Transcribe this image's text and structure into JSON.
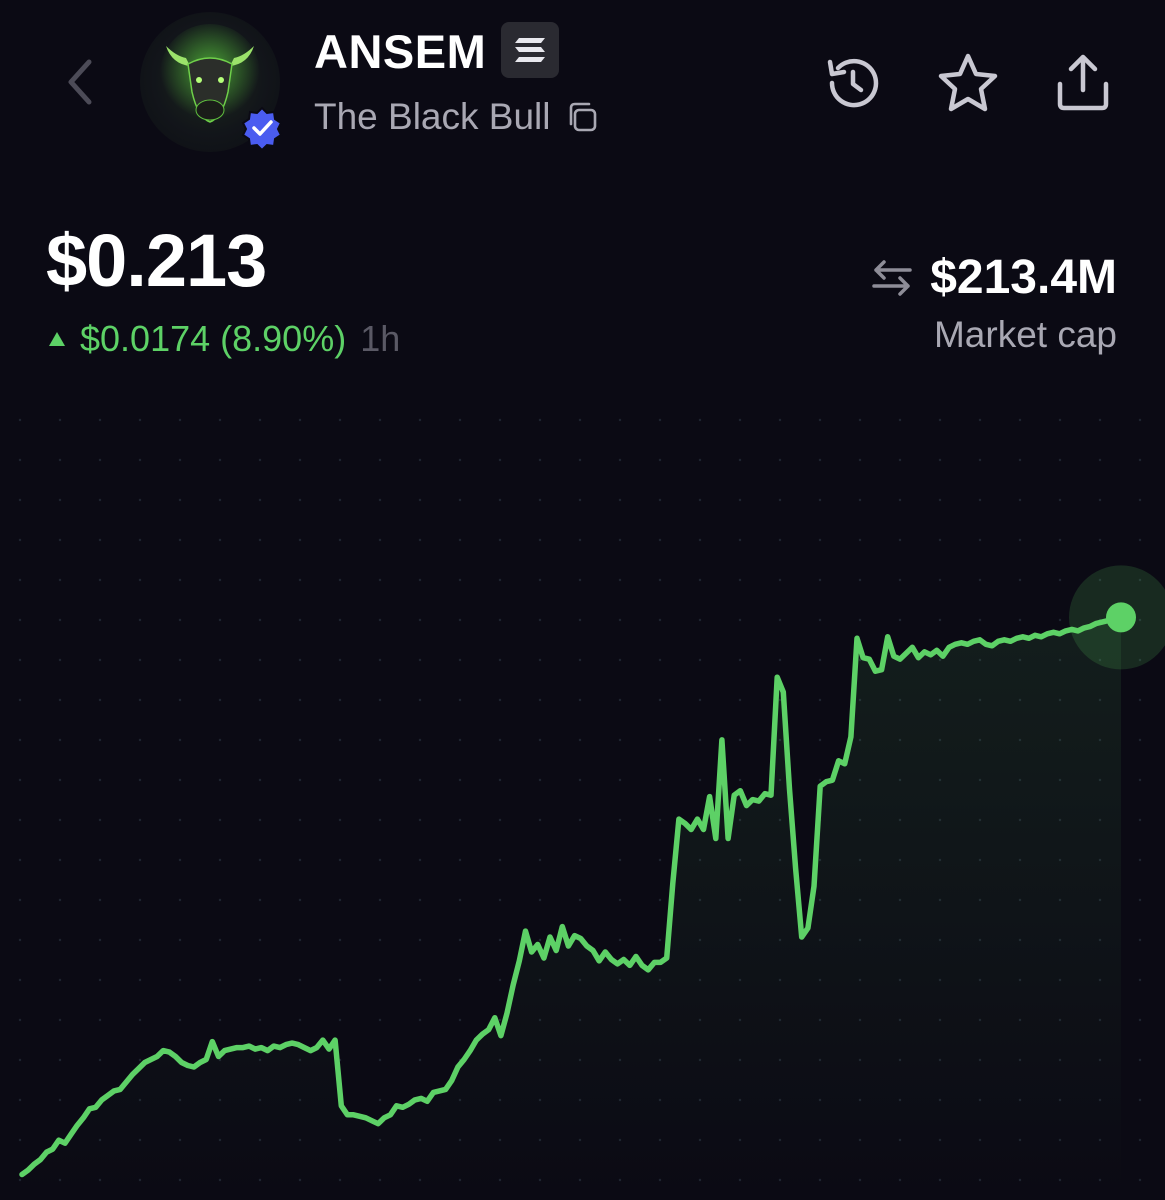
{
  "header": {
    "token_name": "ANSEM",
    "token_subtitle": "The Black Bull",
    "avatar_icon": "bull-icon",
    "verified_icon": "verified-badge-icon",
    "chain_icon": "solana-icon"
  },
  "toolbar": {
    "back_icon": "chevron-left-icon",
    "history_icon": "history-icon",
    "favorite_icon": "star-icon",
    "share_icon": "share-icon"
  },
  "price": {
    "current": "$0.213",
    "change": "$0.0174 (8.90%)",
    "period": "1h",
    "direction": "up"
  },
  "market_cap": {
    "value": "$213.4M",
    "label": "Market cap",
    "swap_icon": "swap-arrows-icon"
  },
  "colors": {
    "background": "#0b0a14",
    "line": "#5dd166",
    "muted_text": "#a9a8b3",
    "verified": "#4a5cf0"
  },
  "chart_data": {
    "type": "line",
    "grid": true,
    "ylim": [
      0.175,
      0.222
    ],
    "x": [
      0,
      1,
      2,
      3,
      4,
      5,
      6,
      7,
      8,
      9,
      10,
      11,
      12,
      13,
      14,
      15,
      16,
      17,
      18,
      19,
      20,
      21,
      22,
      23,
      24,
      25,
      26,
      27,
      28,
      29,
      30,
      31,
      32,
      33,
      34,
      35,
      36,
      37,
      38,
      39,
      40,
      41,
      42,
      43,
      44,
      45,
      46,
      47,
      48,
      49,
      50,
      51,
      52,
      53,
      54,
      55,
      56,
      57,
      58,
      59,
      60,
      61,
      62,
      63,
      64,
      65,
      66,
      67,
      68,
      69,
      70,
      71,
      72,
      73,
      74,
      75,
      76,
      77,
      78,
      79,
      80,
      81,
      82,
      83,
      84,
      85,
      86,
      87,
      88,
      89,
      90,
      91,
      92,
      93,
      94,
      95,
      96,
      97,
      98,
      99,
      100,
      101,
      102,
      103,
      104,
      105,
      106,
      107,
      108,
      109,
      110,
      111,
      112,
      113,
      114,
      115,
      116,
      117,
      118,
      119,
      120,
      121,
      122,
      123,
      124,
      125,
      126,
      127,
      128,
      129,
      130,
      131,
      132,
      133,
      134,
      135,
      136,
      137,
      138,
      139,
      140,
      141,
      142,
      143,
      144,
      145,
      146,
      147,
      148,
      149,
      150,
      151,
      152,
      153,
      154,
      155,
      156,
      157,
      158,
      159,
      160,
      161,
      162,
      163,
      164,
      165,
      166,
      167,
      168,
      169,
      170,
      171,
      172,
      173,
      174,
      175,
      176,
      177,
      178,
      179
    ],
    "values": [
      0.1755,
      0.1758,
      0.1762,
      0.1765,
      0.177,
      0.1772,
      0.1778,
      0.1776,
      0.1782,
      0.1788,
      0.1793,
      0.1799,
      0.18,
      0.1805,
      0.1808,
      0.1811,
      0.1812,
      0.1817,
      0.1822,
      0.1826,
      0.183,
      0.1832,
      0.1834,
      0.1838,
      0.1837,
      0.1834,
      0.183,
      0.1828,
      0.1827,
      0.183,
      0.1832,
      0.1844,
      0.1834,
      0.1838,
      0.1839,
      0.184,
      0.184,
      0.1841,
      0.1839,
      0.184,
      0.1838,
      0.1841,
      0.184,
      0.1842,
      0.1843,
      0.1842,
      0.184,
      0.1838,
      0.184,
      0.1845,
      0.1839,
      0.1845,
      0.1801,
      0.1795,
      0.1795,
      0.1794,
      0.1793,
      0.1791,
      0.1789,
      0.1793,
      0.1795,
      0.1801,
      0.18,
      0.1802,
      0.1805,
      0.1806,
      0.1804,
      0.181,
      0.1811,
      0.1812,
      0.1818,
      0.1827,
      0.1832,
      0.1838,
      0.1845,
      0.1849,
      0.1852,
      0.186,
      0.1848,
      0.1863,
      0.1882,
      0.1898,
      0.1918,
      0.1904,
      0.1909,
      0.19,
      0.1914,
      0.1905,
      0.1921,
      0.1908,
      0.1915,
      0.1913,
      0.1908,
      0.1905,
      0.1898,
      0.1904,
      0.1899,
      0.1896,
      0.1899,
      0.1895,
      0.1901,
      0.1895,
      0.1892,
      0.1897,
      0.1897,
      0.19,
      0.195,
      0.1993,
      0.199,
      0.1986,
      0.1993,
      0.1986,
      0.2008,
      0.198,
      0.2046,
      0.198,
      0.2009,
      0.2012,
      0.2002,
      0.2006,
      0.2005,
      0.201,
      0.2009,
      0.2088,
      0.2078,
      0.2013,
      0.196,
      0.1914,
      0.192,
      0.1948,
      0.2015,
      0.2018,
      0.2019,
      0.2032,
      0.203,
      0.2048,
      0.2114,
      0.2101,
      0.21,
      0.2092,
      0.2093,
      0.2115,
      0.2102,
      0.21,
      0.2104,
      0.2108,
      0.2101,
      0.2105,
      0.2103,
      0.2106,
      0.2102,
      0.2108,
      0.211,
      0.2111,
      0.211,
      0.2112,
      0.2113,
      0.211,
      0.2109,
      0.2112,
      0.2113,
      0.2112,
      0.2114,
      0.2115,
      0.2114,
      0.2116,
      0.2115,
      0.2117,
      0.2118,
      0.2117,
      0.2119,
      0.212,
      0.2119,
      0.2121,
      0.2122,
      0.2124,
      0.2125,
      0.2126,
      0.2127,
      0.2128,
      0.2129,
      0.213
    ]
  }
}
